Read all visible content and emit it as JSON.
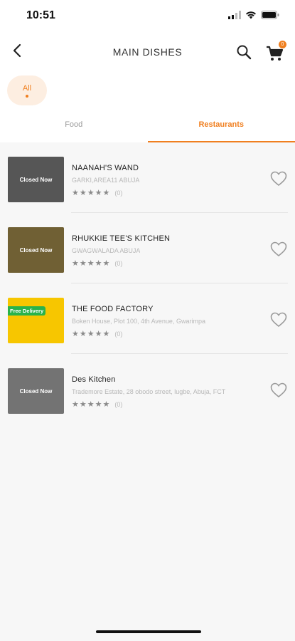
{
  "status": {
    "time": "10:51"
  },
  "header": {
    "title": "MAIN DISHES",
    "cart_count": "0"
  },
  "filter": {
    "chip_label": "All"
  },
  "tabs": [
    {
      "label": "Food",
      "active": false
    },
    {
      "label": "Restaurants",
      "active": true
    }
  ],
  "restaurants": [
    {
      "name": "NAANAH'S WAND",
      "address": "GARKI,AREA11 ABUJA",
      "rating_count": "(0)",
      "badge": "Closed Now",
      "thumb_color": "#9a9a9a"
    },
    {
      "name": "RHUKKIE TEE'S KITCHEN",
      "address": "GWAGWALADA ABUJA",
      "rating_count": "(0)",
      "badge": "Closed Now",
      "thumb_color": "#d9b24a"
    },
    {
      "name": "THE FOOD FACTORY",
      "address": "Boken House, Plot 100, 4th Avenue, Gwarimpa",
      "rating_count": "(0)",
      "badge": "Free Delivery",
      "thumb_color": "#f7c600"
    },
    {
      "name": "Des Kitchen",
      "address": "Trademore Estate, 28 obodo street, lugbe, Abuja, FCT",
      "rating_count": "(0)",
      "badge": "Closed Now",
      "thumb_color": "#cfcfcf"
    }
  ],
  "colors": {
    "accent": "#f07f1f",
    "free_delivery": "#29b34a"
  },
  "icons": {
    "back": "arrow-left-icon",
    "search": "search-icon",
    "cart": "cart-icon",
    "heart": "heart-outline-icon",
    "star": "star-icon"
  }
}
